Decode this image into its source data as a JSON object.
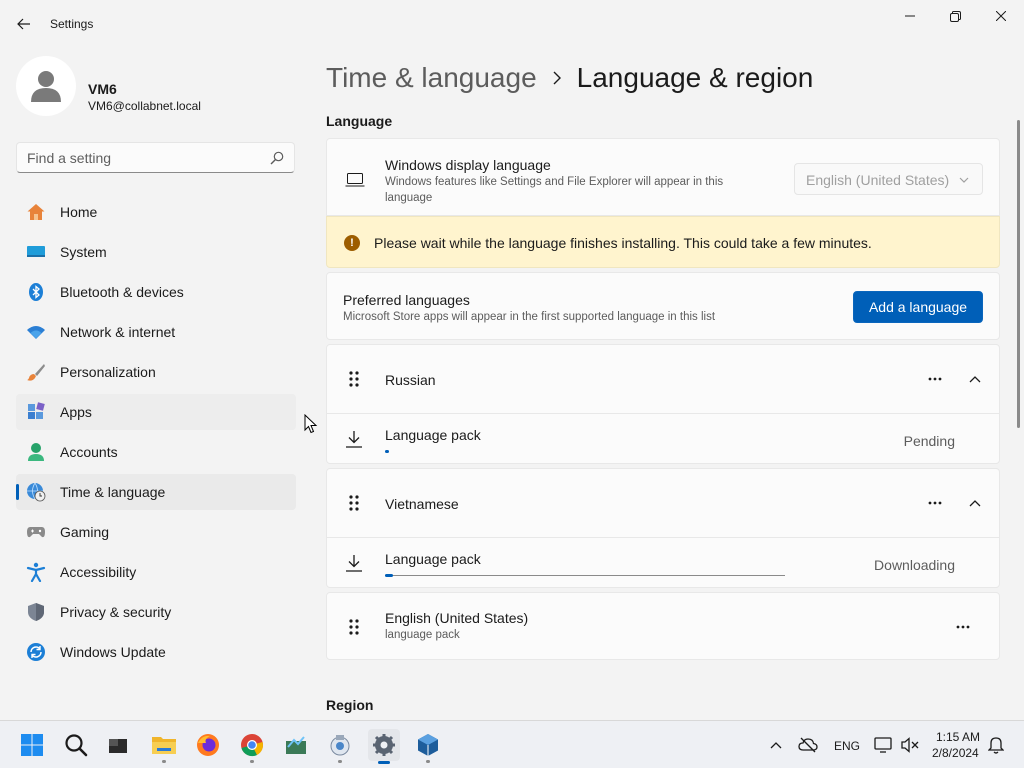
{
  "window": {
    "title": "Settings",
    "back_icon": "arrow-left-icon",
    "controls": [
      "minimize-icon",
      "maximize-icon",
      "close-icon"
    ]
  },
  "profile": {
    "name": "VM6",
    "email": "VM6@collabnet.local"
  },
  "search": {
    "placeholder": "Find a setting",
    "value": ""
  },
  "sidebar": {
    "active": "Time & language",
    "items": [
      {
        "label": "Home",
        "icon": "home-icon"
      },
      {
        "label": "System",
        "icon": "display-icon"
      },
      {
        "label": "Bluetooth & devices",
        "icon": "bluetooth-icon"
      },
      {
        "label": "Network & internet",
        "icon": "wifi-icon"
      },
      {
        "label": "Personalization",
        "icon": "brush-icon"
      },
      {
        "label": "Apps",
        "icon": "apps-icon"
      },
      {
        "label": "Accounts",
        "icon": "account-icon"
      },
      {
        "label": "Time & language",
        "icon": "globe-clock-icon"
      },
      {
        "label": "Gaming",
        "icon": "gamepad-icon"
      },
      {
        "label": "Accessibility",
        "icon": "accessibility-icon"
      },
      {
        "label": "Privacy & security",
        "icon": "shield-icon"
      },
      {
        "label": "Windows Update",
        "icon": "update-icon"
      }
    ]
  },
  "breadcrumb": {
    "parent": "Time & language",
    "current": "Language & region"
  },
  "language_section": {
    "title": "Language",
    "display_language": {
      "title": "Windows display language",
      "description": "Windows features like Settings and File Explorer will appear in this language",
      "selected": "English (United States)"
    },
    "warning": "Please wait while the language finishes installing. This could take a few minutes.",
    "preferred": {
      "title": "Preferred languages",
      "description": "Microsoft Store apps will appear in the first supported language in this list",
      "add_button": "Add a language"
    },
    "languages": [
      {
        "name": "Russian",
        "pack_label": "Language pack",
        "status": "Pending",
        "progress": 0.01
      },
      {
        "name": "Vietnamese",
        "pack_label": "Language pack",
        "status": "Downloading",
        "progress": 0.02
      },
      {
        "name": "English (United States)",
        "subtitle": "language pack"
      }
    ]
  },
  "region_section": {
    "title": "Region"
  },
  "taskbar": {
    "apps": [
      "start-icon",
      "search-icon",
      "terminal-icon",
      "file-explorer-icon",
      "firefox-icon",
      "chrome-icon",
      "pinned-app-icon",
      "pinned-app-icon",
      "settings-icon",
      "virtualbox-icon"
    ],
    "tray": {
      "input": "ENG",
      "time": "1:15 AM",
      "date": "2/8/2024"
    }
  },
  "colors": {
    "accent": "#005fb8",
    "warning_bg": "#fff4ce",
    "warning_icon": "#9d5d00"
  }
}
